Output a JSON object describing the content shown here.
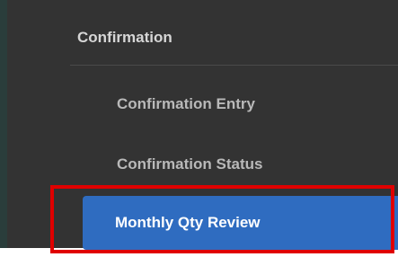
{
  "sidebar": {
    "section_title": "Confirmation",
    "items": [
      {
        "label": "Confirmation Entry"
      },
      {
        "label": "Confirmation Status"
      },
      {
        "label": "Monthly Qty Review",
        "active": true
      }
    ]
  },
  "colors": {
    "sidebar_bg": "#333333",
    "active_bg": "#2f6cc0",
    "highlight_border": "#e00000"
  }
}
